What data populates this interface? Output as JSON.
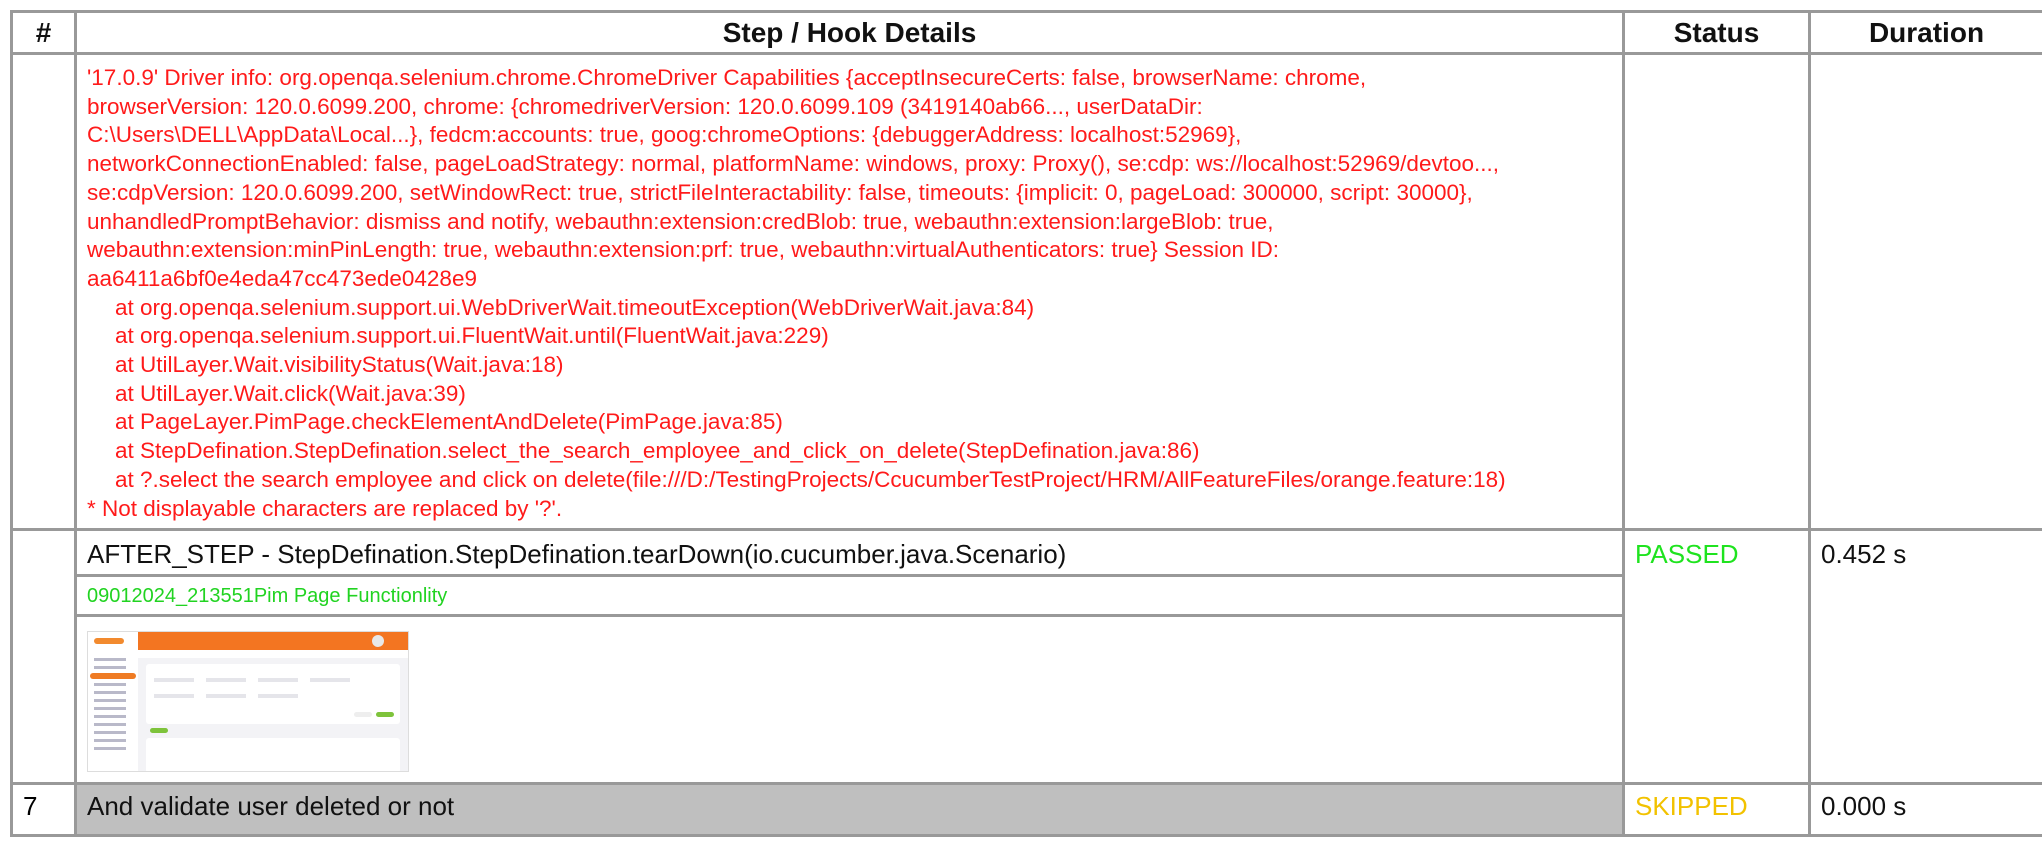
{
  "table": {
    "headers": {
      "num": "#",
      "step": "Step / Hook Details",
      "status": "Status",
      "duration": "Duration"
    }
  },
  "error_block": {
    "message_lines": [
      "'17.0.9' Driver info: org.openqa.selenium.chrome.ChromeDriver Capabilities {acceptInsecureCerts: false, browserName: chrome,",
      "browserVersion: 120.0.6099.200, chrome: {chromedriverVersion: 120.0.6099.109 (3419140ab66..., userDataDir:",
      "C:\\Users\\DELL\\AppData\\Local...}, fedcm:accounts: true, goog:chromeOptions: {debuggerAddress: localhost:52969},",
      "networkConnectionEnabled: false, pageLoadStrategy: normal, platformName: windows, proxy: Proxy(), se:cdp: ws://localhost:52969/devtoo...,",
      "se:cdpVersion: 120.0.6099.200, setWindowRect: true, strictFileInteractability: false, timeouts: {implicit: 0, pageLoad: 300000, script: 30000},",
      "unhandledPromptBehavior: dismiss and notify, webauthn:extension:credBlob: true, webauthn:extension:largeBlob: true,",
      "webauthn:extension:minPinLength: true, webauthn:extension:prf: true, webauthn:virtualAuthenticators: true} Session ID:",
      "aa6411a6bf0e4eda47cc473ede0428e9"
    ],
    "stack_lines": [
      "at org.openqa.selenium.support.ui.WebDriverWait.timeoutException(WebDriverWait.java:84)",
      "at org.openqa.selenium.support.ui.FluentWait.until(FluentWait.java:229)",
      "at UtilLayer.Wait.visibilityStatus(Wait.java:18)",
      "at UtilLayer.Wait.click(Wait.java:39)",
      "at PageLayer.PimPage.checkElementAndDelete(PimPage.java:85)",
      "at StepDefination.StepDefination.select_the_search_employee_and_click_on_delete(StepDefination.java:86)",
      "at ?.select the search employee and click on delete(file:///D:/TestingProjects/CcucumberTestProject/HRM/AllFeatureFiles/orange.feature:18)"
    ],
    "footer": "* Not displayable characters are replaced by '?'."
  },
  "hook": {
    "title": "AFTER_STEP - StepDefination.StepDefination.tearDown(io.cucumber.java.Scenario)",
    "embed_name": "09012024_213551Pim Page Functionlity",
    "status": "PASSED",
    "duration": "0.452 s",
    "status_color": "#1fe31f"
  },
  "row7": {
    "num": "7",
    "step": "And validate user deleted or not",
    "status": "SKIPPED",
    "duration": "0.000 s",
    "status_color": "#f2c200"
  },
  "colors": {
    "error_text": "#ff1a1a",
    "border": "#999999",
    "skipped_row_bg": "#bfbfbf",
    "thumb_orange": "#f37521"
  }
}
